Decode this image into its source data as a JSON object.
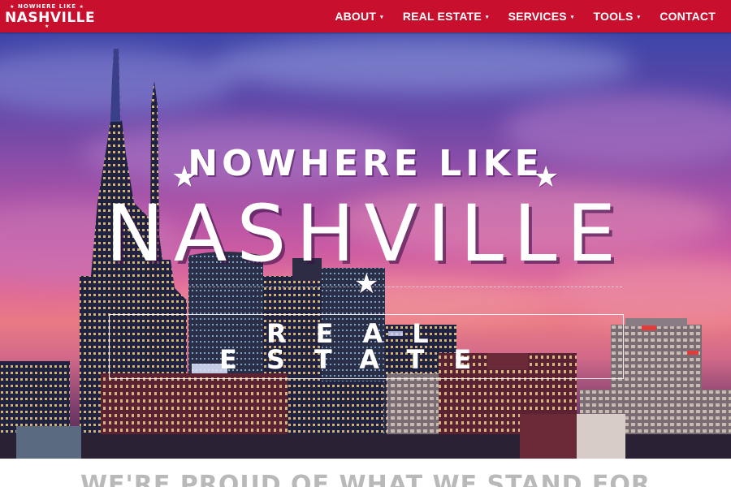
{
  "header": {
    "logo_top": "NOWHERE LIKE",
    "logo_main": "NASHVILLE",
    "nav": [
      {
        "label": "ABOUT",
        "has_dropdown": true
      },
      {
        "label": "REAL ESTATE",
        "has_dropdown": true
      },
      {
        "label": "SERVICES",
        "has_dropdown": true
      },
      {
        "label": "TOOLS",
        "has_dropdown": true
      },
      {
        "label": "CONTACT",
        "has_dropdown": false
      }
    ],
    "caret_glyph": "▾"
  },
  "hero": {
    "kicker": "NOWHERE LIKE",
    "title": "NASHVILLE",
    "subtitle_line1": "REAL",
    "subtitle_line2": "ESTATE",
    "star_glyph": "★"
  },
  "section": {
    "title": "WE'RE PROUD OF WHAT WE STAND FOR"
  },
  "colors": {
    "brand_red": "#c8102e",
    "nav_text": "#ffffff",
    "section_title": "#b9b9b9"
  }
}
